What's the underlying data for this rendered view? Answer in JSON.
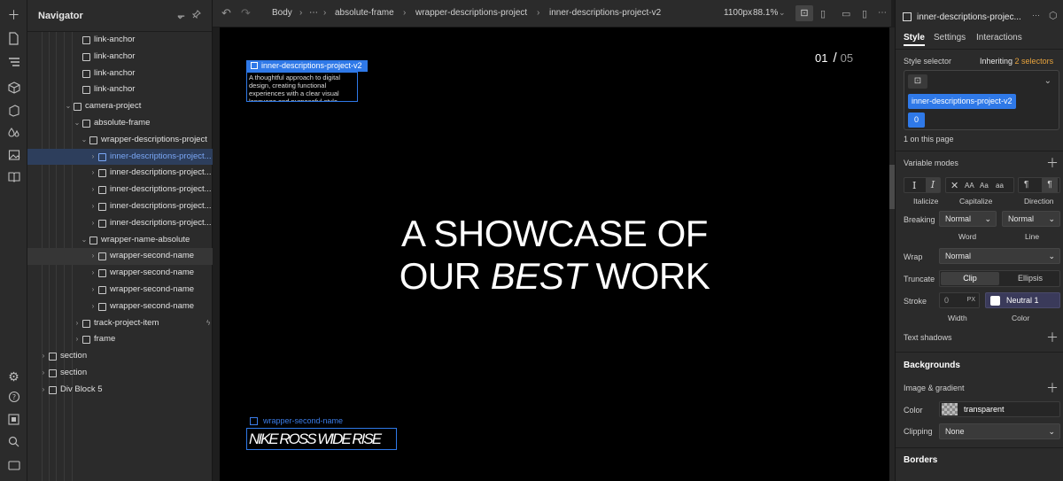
{
  "navigator": {
    "title": "Navigator",
    "tree": [
      {
        "label": "link-anchor",
        "depth": 3,
        "caret": ""
      },
      {
        "label": "link-anchor",
        "depth": 3,
        "caret": ""
      },
      {
        "label": "link-anchor",
        "depth": 3,
        "caret": ""
      },
      {
        "label": "link-anchor",
        "depth": 3,
        "caret": ""
      },
      {
        "label": "camera-project",
        "depth": 2,
        "caret": "⌄"
      },
      {
        "label": "absolute-frame",
        "depth": 3,
        "caret": "⌄"
      },
      {
        "label": "wrapper-descriptions-project",
        "depth": 4,
        "caret": "⌄"
      },
      {
        "label": "inner-descriptions-project...",
        "depth": 5,
        "caret": "›",
        "state": "selected"
      },
      {
        "label": "inner-descriptions-project...",
        "depth": 5,
        "caret": "›"
      },
      {
        "label": "inner-descriptions-project...",
        "depth": 5,
        "caret": "›"
      },
      {
        "label": "inner-descriptions-project...",
        "depth": 5,
        "caret": "›"
      },
      {
        "label": "inner-descriptions-project...",
        "depth": 5,
        "caret": "›"
      },
      {
        "label": "wrapper-name-absolute",
        "depth": 4,
        "caret": "⌄"
      },
      {
        "label": "wrapper-second-name",
        "depth": 5,
        "caret": "›",
        "state": "hovered"
      },
      {
        "label": "wrapper-second-name",
        "depth": 5,
        "caret": "›"
      },
      {
        "label": "wrapper-second-name",
        "depth": 5,
        "caret": "›"
      },
      {
        "label": "wrapper-second-name",
        "depth": 5,
        "caret": "›"
      },
      {
        "label": "track-project-item",
        "depth": 3,
        "caret": "›",
        "bolt": "ϟ"
      },
      {
        "label": "frame",
        "depth": 3,
        "caret": "›"
      },
      {
        "label": "section",
        "depth": 1,
        "caret": "›"
      },
      {
        "label": "section",
        "depth": 1,
        "caret": "›"
      },
      {
        "label": "Div Block 5",
        "depth": 1,
        "caret": "›"
      }
    ]
  },
  "breadcrumb": {
    "items": [
      "Body",
      "⋯",
      "absolute-frame",
      "wrapper-descriptions-project",
      "inner-descriptions-project-v2"
    ],
    "separator": "›",
    "viewport": "1100px",
    "zoom": "88.1%"
  },
  "canvas": {
    "selected_label": "inner-descriptions-project-v2",
    "selected_text": "A thoughtful approach to digital design, creating functional experiences with a clear visual language and purposeful style.",
    "counter_current": "01",
    "counter_sep": "/",
    "counter_total": "05",
    "hero_line1": "A SHOWCASE OF",
    "hero_line2_pre": "OUR ",
    "hero_line2_em": "BEST",
    "hero_line2_post": " WORK",
    "second_name_label": "wrapper-second-name",
    "second_name_text": "NIKE ROSS WIDE RISE"
  },
  "panel": {
    "element_name": "inner-descriptions-projec...",
    "tabs": [
      "Style",
      "Settings",
      "Interactions"
    ],
    "style_selector_label": "Style selector",
    "inheriting_prefix": "Inheriting",
    "inheriting_count": "2 selectors",
    "selector_class": "inner-descriptions-project-v2",
    "selector_combo": "0",
    "on_page": "1 on this page",
    "variable_modes": "Variable modes",
    "italicize_label": "Italicize",
    "capitalize_label": "Capitalize",
    "direction_label": "Direction",
    "capitalize_options": [
      "AA",
      "Aa",
      "aa"
    ],
    "breaking_label": "Breaking",
    "word_value": "Normal",
    "line_value": "Normal",
    "word_label": "Word",
    "line_label": "Line",
    "wrap_label": "Wrap",
    "wrap_value": "Normal",
    "truncate_label": "Truncate",
    "truncate_clip": "Clip",
    "truncate_ellipsis": "Ellipsis",
    "stroke_label": "Stroke",
    "stroke_width": "0",
    "stroke_unit": "PX",
    "stroke_color": "Neutral 1",
    "width_label": "Width",
    "color_label": "Color",
    "text_shadows": "Text shadows",
    "backgrounds": "Backgrounds",
    "image_gradient": "Image & gradient",
    "bg_color_label": "Color",
    "bg_color_value": "transparent",
    "clipping_label": "Clipping",
    "clipping_value": "None",
    "borders": "Borders"
  },
  "colors": {
    "accent": "#2f79e8",
    "selector_orange": "#e8a33c"
  }
}
